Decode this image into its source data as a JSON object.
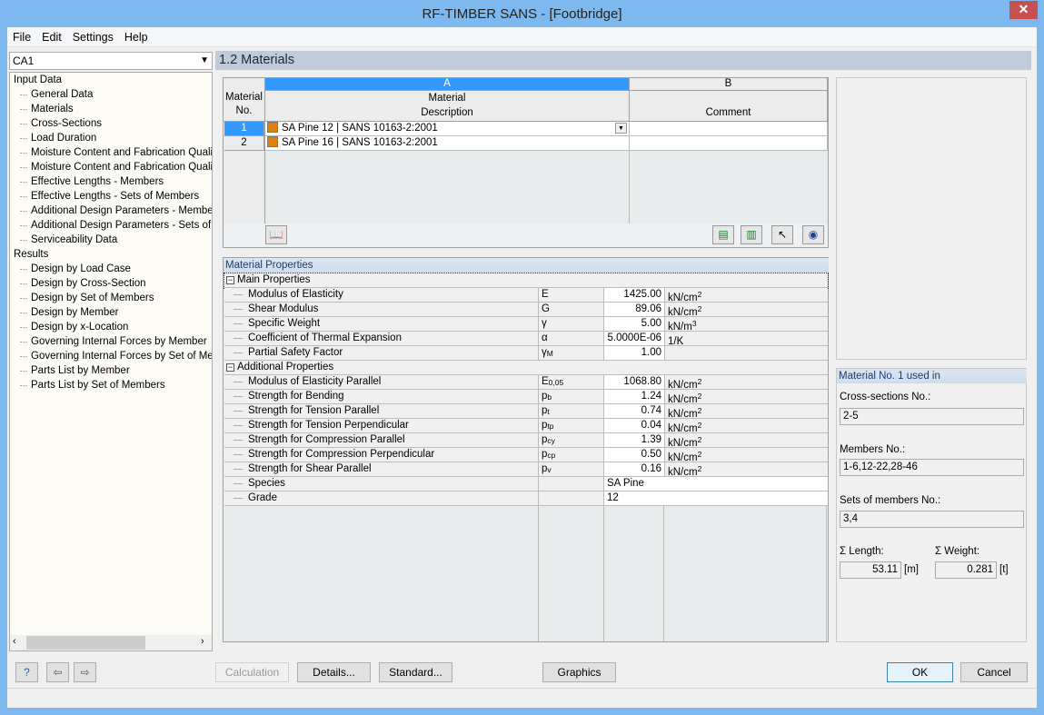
{
  "window": {
    "title": "RF-TIMBER SANS - [Footbridge]"
  },
  "menu": [
    "File",
    "Edit",
    "Settings",
    "Help"
  ],
  "case_select": "CA1",
  "tree": [
    {
      "label": "Input Data",
      "level": 1
    },
    {
      "label": "General Data",
      "level": 2
    },
    {
      "label": "Materials",
      "level": 2
    },
    {
      "label": "Cross-Sections",
      "level": 2
    },
    {
      "label": "Load Duration",
      "level": 2
    },
    {
      "label": "Moisture Content and Fabrication Quality",
      "level": 2
    },
    {
      "label": "Moisture Content and Fabrication Quality",
      "level": 2
    },
    {
      "label": "Effective Lengths - Members",
      "level": 2
    },
    {
      "label": "Effective Lengths - Sets of Members",
      "level": 2
    },
    {
      "label": "Additional Design Parameters - Members",
      "level": 2
    },
    {
      "label": "Additional Design Parameters - Sets of Me",
      "level": 2
    },
    {
      "label": "Serviceability Data",
      "level": 2
    },
    {
      "label": "Results",
      "level": 1
    },
    {
      "label": "Design by Load Case",
      "level": 2
    },
    {
      "label": "Design by Cross-Section",
      "level": 2
    },
    {
      "label": "Design by Set of Members",
      "level": 2
    },
    {
      "label": "Design by Member",
      "level": 2
    },
    {
      "label": "Design by x-Location",
      "level": 2
    },
    {
      "label": "Governing Internal Forces by Member",
      "level": 2
    },
    {
      "label": "Governing Internal Forces by Set of Mem",
      "level": 2
    },
    {
      "label": "Parts List by Member",
      "level": 2
    },
    {
      "label": "Parts List by Set of Members",
      "level": 2
    }
  ],
  "section_title": "1.2 Materials",
  "table": {
    "col_a": "A",
    "col_b": "B",
    "h_no_1": "Material",
    "h_no_2": "No.",
    "h_desc_1": "Material",
    "h_desc_2": "Description",
    "h_comment": "Comment",
    "rows": [
      {
        "no": "1",
        "desc": "SA Pine 12 | SANS 10163-2:2001",
        "comment": ""
      },
      {
        "no": "2",
        "desc": "SA Pine 16 | SANS 10163-2:2001",
        "comment": ""
      }
    ],
    "material_color": "#e0820a"
  },
  "props": {
    "title": "Material Properties",
    "groups": [
      {
        "label": "Main Properties",
        "rows": [
          {
            "name": "Modulus of Elasticity",
            "sym": "E",
            "sub": "",
            "value": "1425.00",
            "unit": "kN/cm",
            "exp": "2"
          },
          {
            "name": "Shear Modulus",
            "sym": "G",
            "sub": "",
            "value": "89.06",
            "unit": "kN/cm",
            "exp": "2"
          },
          {
            "name": "Specific Weight",
            "sym": "γ",
            "sub": "",
            "value": "5.00",
            "unit": "kN/m",
            "exp": "3"
          },
          {
            "name": "Coefficient of Thermal Expansion",
            "sym": "α",
            "sub": "",
            "value": "5.0000E-06",
            "unit": "1/K",
            "exp": ""
          },
          {
            "name": "Partial Safety Factor",
            "sym": "γ",
            "sub": "M",
            "value": "1.00",
            "unit": "",
            "exp": ""
          }
        ]
      },
      {
        "label": "Additional Properties",
        "rows": [
          {
            "name": "Modulus of Elasticity Parallel",
            "sym": "E",
            "sub": "0,05",
            "value": "1068.80",
            "unit": "kN/cm",
            "exp": "2"
          },
          {
            "name": "Strength for Bending",
            "sym": "p",
            "sub": "b",
            "value": "1.24",
            "unit": "kN/cm",
            "exp": "2"
          },
          {
            "name": "Strength for Tension Parallel",
            "sym": "p",
            "sub": "t",
            "value": "0.74",
            "unit": "kN/cm",
            "exp": "2"
          },
          {
            "name": "Strength for Tension Perpendicular",
            "sym": "p",
            "sub": "tp",
            "value": "0.04",
            "unit": "kN/cm",
            "exp": "2"
          },
          {
            "name": "Strength for Compression Parallel",
            "sym": "p",
            "sub": "cy",
            "value": "1.39",
            "unit": "kN/cm",
            "exp": "2"
          },
          {
            "name": "Strength for Compression Perpendicular",
            "sym": "p",
            "sub": "cp",
            "value": "0.50",
            "unit": "kN/cm",
            "exp": "2"
          },
          {
            "name": "Strength for Shear Parallel",
            "sym": "p",
            "sub": "v",
            "value": "0.16",
            "unit": "kN/cm",
            "exp": "2"
          },
          {
            "name": "Species",
            "sym": "",
            "sub": "",
            "value": "SA Pine",
            "unit": "",
            "exp": "",
            "text": true
          },
          {
            "name": "Grade",
            "sym": "",
            "sub": "",
            "value": "12",
            "unit": "",
            "exp": "",
            "text": true
          }
        ]
      }
    ]
  },
  "info": {
    "title": "Material No. 1 used in",
    "cs_label": "Cross-sections No.:",
    "cs_value": "2-5",
    "members_label": "Members No.:",
    "members_value": "1-6,12-22,28-46",
    "sets_label": "Sets of members No.:",
    "sets_value": "3,4",
    "length_label": "Σ Length:",
    "length_value": "53.11",
    "length_unit": "[m]",
    "weight_label": "Σ Weight:",
    "weight_value": "0.281",
    "weight_unit": "[t]"
  },
  "buttons": {
    "calculation": "Calculation",
    "details": "Details...",
    "standard": "Standard...",
    "graphics": "Graphics",
    "ok": "OK",
    "cancel": "Cancel"
  }
}
